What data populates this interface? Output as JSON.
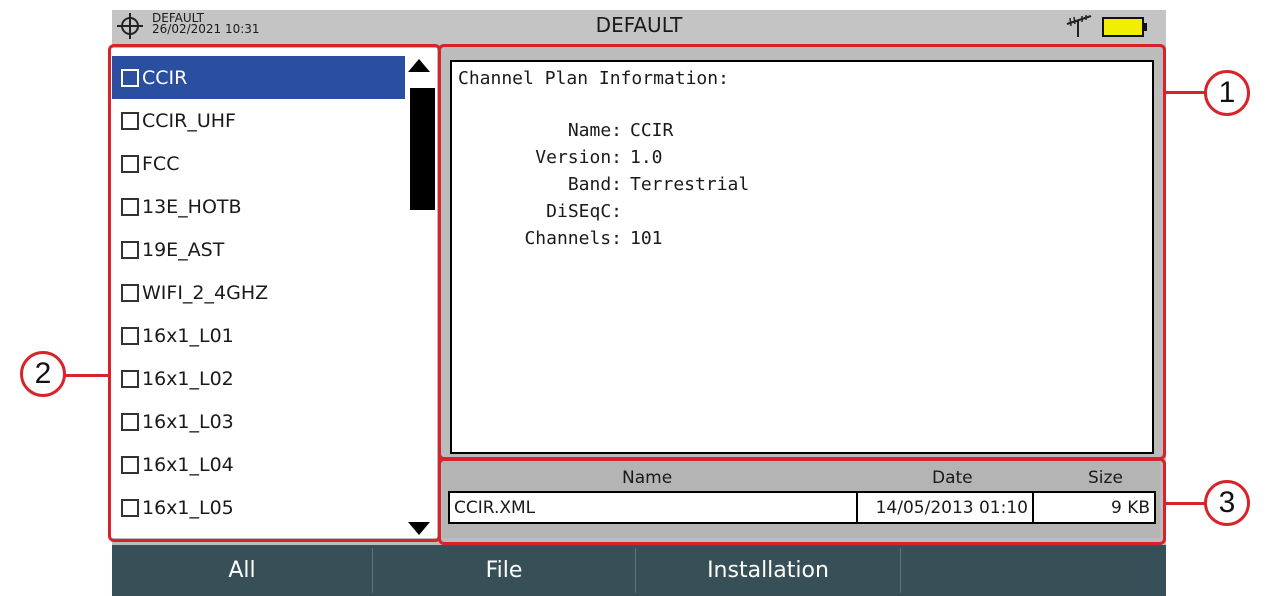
{
  "status": {
    "profile": "DEFAULT",
    "datetime": "26/02/2021 10:31",
    "title": "DEFAULT",
    "battery_color": "#f2ee00"
  },
  "channel_list": [
    {
      "label": "CCIR",
      "selected": true
    },
    {
      "label": "CCIR_UHF",
      "selected": false
    },
    {
      "label": "FCC",
      "selected": false
    },
    {
      "label": "13E_HOTB",
      "selected": false
    },
    {
      "label": "19E_AST",
      "selected": false
    },
    {
      "label": "WIFI_2_4GHZ",
      "selected": false
    },
    {
      "label": "16x1_L01",
      "selected": false
    },
    {
      "label": "16x1_L02",
      "selected": false
    },
    {
      "label": "16x1_L03",
      "selected": false
    },
    {
      "label": "16x1_L04",
      "selected": false
    },
    {
      "label": "16x1_L05",
      "selected": false
    }
  ],
  "info": {
    "heading": "Channel Plan Information:",
    "fields": [
      {
        "label": "Name:",
        "value": "CCIR"
      },
      {
        "label": "Version:",
        "value": "1.0"
      },
      {
        "label": "Band:",
        "value": "Terrestrial"
      },
      {
        "label": "DiSEqC:",
        "value": ""
      },
      {
        "label": "Channels:",
        "value": "101"
      }
    ]
  },
  "file_table": {
    "headers": {
      "name": "Name",
      "date": "Date",
      "size": "Size"
    },
    "row": {
      "name": "CCIR.XML",
      "date": "14/05/2013 01:10",
      "size": "9 KB"
    }
  },
  "function_keys": [
    "All",
    "File",
    "Installation",
    ""
  ],
  "annotations": {
    "c1": "1",
    "c2": "2",
    "c3": "3"
  },
  "colors": {
    "selection": "#2a4fa0",
    "annotation": "#d8232a",
    "function_bar": "#375058"
  }
}
